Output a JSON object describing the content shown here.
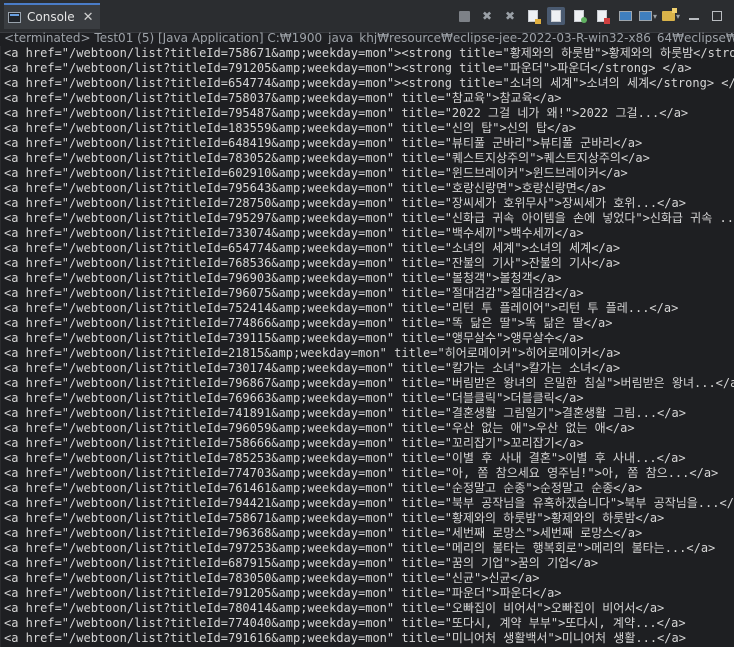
{
  "tab": {
    "title": "Console"
  },
  "status_line": "<terminated> Test01 (5) [Java Application] C:₩1900_java_khj₩resource₩eclipse-jee-2022-03-R-win32-x86_64₩eclipse₩plugins₩org.ecl",
  "toolbar": {
    "buttons": [
      "terminate-icon",
      "remove-launch-icon",
      "remove-all-icon",
      "scroll-lock-icon",
      "word-wrap-icon",
      "show-stdout-icon",
      "show-stderr-icon",
      "pin-console-icon",
      "display-console-icon",
      "open-console-icon",
      "minimize-icon",
      "maximize-icon"
    ]
  },
  "lines": [
    "<a href=\"/webtoon/list?titleId=758671&amp;weekday=mon\"><strong title=\"황제와의 하룻밤\">황제와의 하룻밤</strong",
    "<a href=\"/webtoon/list?titleId=791205&amp;weekday=mon\"><strong title=\"파운더\">파운더</strong> </a>",
    "<a href=\"/webtoon/list?titleId=654774&amp;weekday=mon\"><strong title=\"소녀의 세계\">소녀의 세계</strong> </a>",
    "<a href=\"/webtoon/list?titleId=758037&amp;weekday=mon\" title=\"참교육\">참교육</a>",
    "<a href=\"/webtoon/list?titleId=795487&amp;weekday=mon\" title=\"2022 그걸 네가 왜!\">2022 그걸...</a>",
    "<a href=\"/webtoon/list?titleId=183559&amp;weekday=mon\" title=\"신의 탑\">신의 탑</a>",
    "<a href=\"/webtoon/list?titleId=648419&amp;weekday=mon\" title=\"뷰티풀 군바리\">뷰티풀 군바리</a>",
    "<a href=\"/webtoon/list?titleId=783052&amp;weekday=mon\" title=\"퀘스트지상주의\">퀘스트지상주의</a>",
    "<a href=\"/webtoon/list?titleId=602910&amp;weekday=mon\" title=\"윈드브레이커\">윈드브레이커</a>",
    "<a href=\"/webtoon/list?titleId=795643&amp;weekday=mon\" title=\"호랑신랑면\">호랑신랑면</a>",
    "<a href=\"/webtoon/list?titleId=728750&amp;weekday=mon\" title=\"장씨세가 호위무사\">장씨세가 호위...</a>",
    "<a href=\"/webtoon/list?titleId=795297&amp;weekday=mon\" title=\"신화급 귀속 아이템을 손에 넣었다\">신화급 귀속 ...</a>",
    "<a href=\"/webtoon/list?titleId=733074&amp;weekday=mon\" title=\"백수세끼\">백수세끼</a>",
    "<a href=\"/webtoon/list?titleId=654774&amp;weekday=mon\" title=\"소녀의 세계\">소녀의 세계</a>",
    "<a href=\"/webtoon/list?titleId=768536&amp;weekday=mon\" title=\"잔불의 기사\">잔불의 기사</a>",
    "<a href=\"/webtoon/list?titleId=796903&amp;weekday=mon\" title=\"볼청객\">볼청객</a>",
    "<a href=\"/webtoon/list?titleId=796075&amp;weekday=mon\" title=\"절대검감\">절대검감</a>",
    "<a href=\"/webtoon/list?titleId=752414&amp;weekday=mon\" title=\"리턴 투 플레이어\">리턴 투 플레...</a>",
    "<a href=\"/webtoon/list?titleId=774866&amp;weekday=mon\" title=\"똑 닮은 딸\">똑 닮은 딸</a>",
    "<a href=\"/webtoon/list?titleId=739115&amp;weekday=mon\" title=\"앵무살수\">앵무살수</a>",
    "<a href=\"/webtoon/list?titleId=21815&amp;weekday=mon\" title=\"히어로메이커\">히어로메이커</a>",
    "<a href=\"/webtoon/list?titleId=730174&amp;weekday=mon\" title=\"칼가는 소녀\">칼가는 소녀</a>",
    "<a href=\"/webtoon/list?titleId=796867&amp;weekday=mon\" title=\"버림받은 왕녀의 은밀한 침실\">버림받은 왕녀...</a>",
    "<a href=\"/webtoon/list?titleId=769663&amp;weekday=mon\" title=\"더블클릭\">더블클릭</a>",
    "<a href=\"/webtoon/list?titleId=741891&amp;weekday=mon\" title=\"결혼생활 그림일기\">결혼생활 그림...</a>",
    "<a href=\"/webtoon/list?titleId=796059&amp;weekday=mon\" title=\"우산 없는 애\">우산 없는 애</a>",
    "<a href=\"/webtoon/list?titleId=758666&amp;weekday=mon\" title=\"꼬리잡기\">꼬리잡기</a>",
    "<a href=\"/webtoon/list?titleId=785253&amp;weekday=mon\" title=\"이별 후 사내 결혼\">이별 후 사내...</a>",
    "<a href=\"/webtoon/list?titleId=774703&amp;weekday=mon\" title=\"아, 쫌 참으세요 영주님!\">아, 쫌 참으...</a>",
    "<a href=\"/webtoon/list?titleId=761461&amp;weekday=mon\" title=\"순정말고 순종\">순정말고 순종</a>",
    "<a href=\"/webtoon/list?titleId=794421&amp;weekday=mon\" title=\"북부 공작님을 유혹하겠습니다\">북부 공작님을...</a>",
    "<a href=\"/webtoon/list?titleId=758671&amp;weekday=mon\" title=\"황제와의 하룻밤\">황제와의 하룻밤</a>",
    "<a href=\"/webtoon/list?titleId=796368&amp;weekday=mon\" title=\"세번째 로망스\">세번째 로망스</a>",
    "<a href=\"/webtoon/list?titleId=797253&amp;weekday=mon\" title=\"메리의 불타는 행복회로\">메리의 불타는...</a>",
    "<a href=\"/webtoon/list?titleId=687915&amp;weekday=mon\" title=\"꿈의 기업\">꿈의 기업</a>",
    "<a href=\"/webtoon/list?titleId=783050&amp;weekday=mon\" title=\"신균\">신균</a>",
    "<a href=\"/webtoon/list?titleId=791205&amp;weekday=mon\" title=\"파운더\">파운더</a>",
    "<a href=\"/webtoon/list?titleId=780414&amp;weekday=mon\" title=\"오빠집이 비어서\">오빠집이 비어서</a>",
    "<a href=\"/webtoon/list?titleId=774040&amp;weekday=mon\" title=\"또다시, 계약 부부\">또다시, 계약...</a>",
    "<a href=\"/webtoon/list?titleId=791616&amp;weekday=mon\" title=\"미니어처 생활백서\">미니어처 생활...</a>"
  ]
}
